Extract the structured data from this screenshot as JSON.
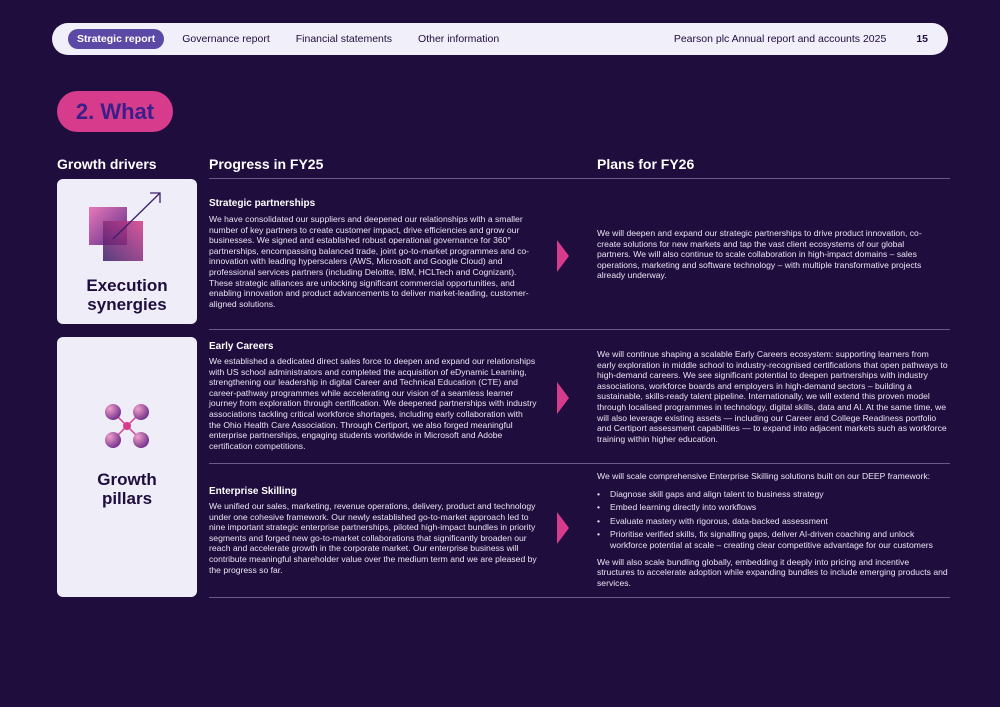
{
  "nav": {
    "tabs": [
      "Strategic report",
      "Governance report",
      "Financial statements",
      "Other information"
    ],
    "report_title": "Pearson plc Annual report and accounts 2025",
    "page_number": "15"
  },
  "section": {
    "title": "2. What"
  },
  "columns": {
    "growth_drivers": "Growth drivers",
    "progress": "Progress in FY25",
    "plans": "Plans for FY26"
  },
  "cards": {
    "execution": {
      "title_line1": "Execution",
      "title_line2": "synergies"
    },
    "growth": {
      "title_line1": "Growth",
      "title_line2": "pillars"
    }
  },
  "rows": {
    "strategic": {
      "title": "Strategic partnerships",
      "progress": "We have consolidated our suppliers and deepened our relationships with a smaller number of key partners to create customer impact, drive efficiencies and grow our businesses. We signed and established robust operational governance for 360° partnerships, encompassing balanced trade, joint go-to-market programmes and co-innovation with leading hyperscalers (AWS, Microsoft and Google Cloud) and professional services partners (including Deloitte, IBM, HCLTech and Cognizant). These strategic alliances are unlocking significant commercial opportunities, and enabling innovation and product advancements to deliver market-leading, customer-aligned solutions.",
      "plan": "We will deepen and expand our strategic partnerships to drive product innovation, co-create solutions for new markets and tap the vast client ecosystems of our global partners. We will also continue to scale collaboration in high-impact domains – sales operations, marketing and software technology – with multiple transformative projects already underway."
    },
    "early": {
      "title": "Early Careers",
      "progress": "We established a dedicated direct sales force to deepen and expand our relationships with US school administrators and completed the acquisition of eDynamic Learning, strengthening our leadership in digital Career and Technical Education (CTE) and career-pathway programmes while accelerating our vision of a seamless learner journey from exploration through certification. We deepened partnerships with industry associations tackling critical workforce shortages, including early collaboration with the Ohio Health Care Association. Through Certiport, we also forged meaningful enterprise partnerships, engaging students worldwide in Microsoft and Adobe certification competitions.",
      "plan": "We will continue shaping a scalable Early Careers ecosystem: supporting learners from early exploration in middle school to industry-recognised certifications that open pathways to high-demand careers. We see significant potential to deepen partnerships with industry associations, workforce boards and employers in high-demand sectors – building a sustainable, skills-ready talent pipeline. Internationally, we will extend this proven model through localised programmes in technology, digital skills, data and AI. At the same time, we will also leverage existing assets — including our Career and College Readiness portfolio and Certiport assessment capabilities — to expand into adjacent markets such as workforce training within higher education."
    },
    "enterprise": {
      "title": "Enterprise Skilling",
      "progress": "We unified our sales, marketing, revenue operations, delivery, product and technology under one cohesive framework. Our newly established go-to-market approach led to nine important strategic enterprise partnerships, piloted high-impact bundles in priority segments and forged new go-to-market collaborations that significantly broaden our reach and accelerate growth in the corporate market. Our enterprise business will contribute meaningful shareholder value over the medium term and we are pleased by the progress so far.",
      "plan_intro": "We will scale comprehensive Enterprise Skilling solutions built on our DEEP framework:",
      "plan_bullets": [
        "Diagnose skill gaps and align talent to business strategy",
        "Embed learning directly into workflows",
        "Evaluate mastery with rigorous, data-backed assessment",
        "Prioritise verified skills, fix signalling gaps, deliver AI-driven coaching and unlock workforce potential at scale – creating clear competitive advantage for our customers"
      ],
      "plan_outro": "We will also scale bundling globally, embedding it deeply into pricing and incentive structures to accelerate adoption while expanding bundles to include emerging products and services."
    }
  },
  "colors": {
    "background": "#1f0d3d",
    "accent": "#d63b8c",
    "nav_active": "#5a4aa6",
    "card": "#efedf7"
  }
}
